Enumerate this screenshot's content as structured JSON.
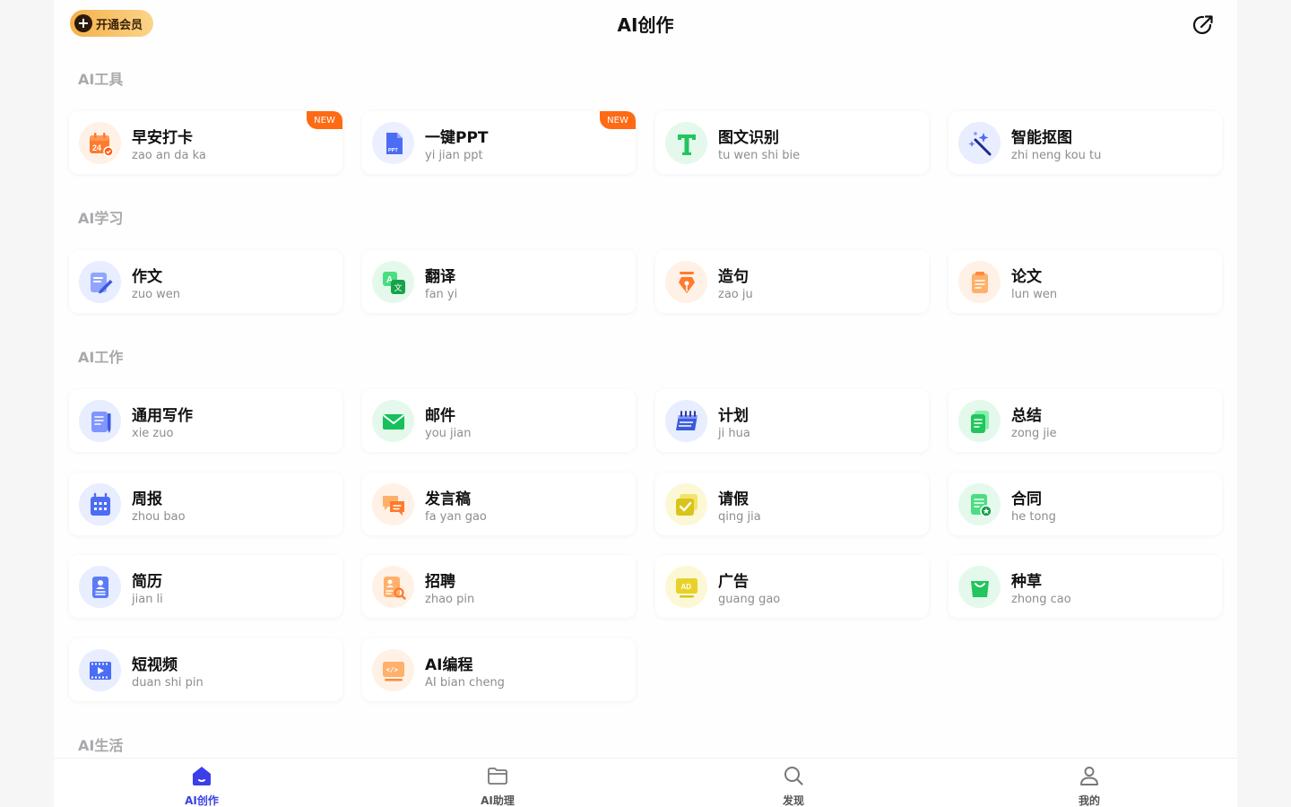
{
  "header": {
    "vip_label": "开通会员",
    "title": "AI创作"
  },
  "sections": {
    "tools": "AI工具",
    "study": "AI学习",
    "work": "AI工作",
    "life": "AI生活"
  },
  "badge_new": "NEW",
  "cards": [
    {
      "name": "早安打卡",
      "pinyin": "zao an da ka",
      "icon": "calendar-checkin-icon",
      "color": "#ff7a2e"
    },
    {
      "name": "一键PPT",
      "pinyin": "yi jian ppt",
      "icon": "ppt-file-icon",
      "color": "#4b6cf5"
    },
    {
      "name": "图文识别",
      "pinyin": "tu wen shi bie",
      "icon": "text-recognition-icon",
      "color": "#22c55e"
    },
    {
      "name": "智能抠图",
      "pinyin": "zhi neng kou tu",
      "icon": "magic-wand-icon",
      "color": "#3b5bdb"
    },
    {
      "name": "作文",
      "pinyin": "zuo wen",
      "icon": "essay-edit-icon",
      "color": "#5b7cf6"
    },
    {
      "name": "翻译",
      "pinyin": "fan yi",
      "icon": "translate-icon",
      "color": "#22c55e"
    },
    {
      "name": "造句",
      "pinyin": "zao ju",
      "icon": "pen-nib-icon",
      "color": "#ff7a2e"
    },
    {
      "name": "论文",
      "pinyin": "lun wen",
      "icon": "paper-document-icon",
      "color": "#ff9a4a"
    },
    {
      "name": "通用写作",
      "pinyin": "xie zuo",
      "icon": "notebook-pen-icon",
      "color": "#5b7cf6"
    },
    {
      "name": "邮件",
      "pinyin": "you jian",
      "icon": "mail-icon",
      "color": "#16c05a"
    },
    {
      "name": "计划",
      "pinyin": "ji hua",
      "icon": "plan-calendar-icon",
      "color": "#3b5bdb"
    },
    {
      "name": "总结",
      "pinyin": "zong jie",
      "icon": "summary-document-icon",
      "color": "#22c55e"
    },
    {
      "name": "周报",
      "pinyin": "zhou bao",
      "icon": "weekly-calendar-icon",
      "color": "#4b6cf5"
    },
    {
      "name": "发言稿",
      "pinyin": "fa yan gao",
      "icon": "speech-bubbles-icon",
      "color": "#ff8a3d"
    },
    {
      "name": "请假",
      "pinyin": "qing jia",
      "icon": "leave-check-icon",
      "color": "#d9c41a"
    },
    {
      "name": "合同",
      "pinyin": "he tong",
      "icon": "contract-star-icon",
      "color": "#22c55e"
    },
    {
      "name": "简历",
      "pinyin": "jian li",
      "icon": "resume-icon",
      "color": "#5b7cf6"
    },
    {
      "name": "招聘",
      "pinyin": "zhao pin",
      "icon": "recruit-search-icon",
      "color": "#ff8a3d"
    },
    {
      "name": "广告",
      "pinyin": "guang gao",
      "icon": "ad-icon",
      "color": "#d9c41a"
    },
    {
      "name": "种草",
      "pinyin": "zhong cao",
      "icon": "shopping-bag-icon",
      "color": "#22c55e"
    },
    {
      "name": "短视频",
      "pinyin": "duan shi pin",
      "icon": "video-play-icon",
      "color": "#4b6cf5"
    },
    {
      "name": "AI编程",
      "pinyin": "AI bian cheng",
      "icon": "code-icon",
      "color": "#ff8a3d"
    }
  ],
  "tabbar": [
    {
      "label": "AI创作",
      "icon": "home-icon"
    },
    {
      "label": "AI助理",
      "icon": "folder-icon"
    },
    {
      "label": "发现",
      "icon": "search-icon"
    },
    {
      "label": "我的",
      "icon": "user-icon"
    }
  ]
}
